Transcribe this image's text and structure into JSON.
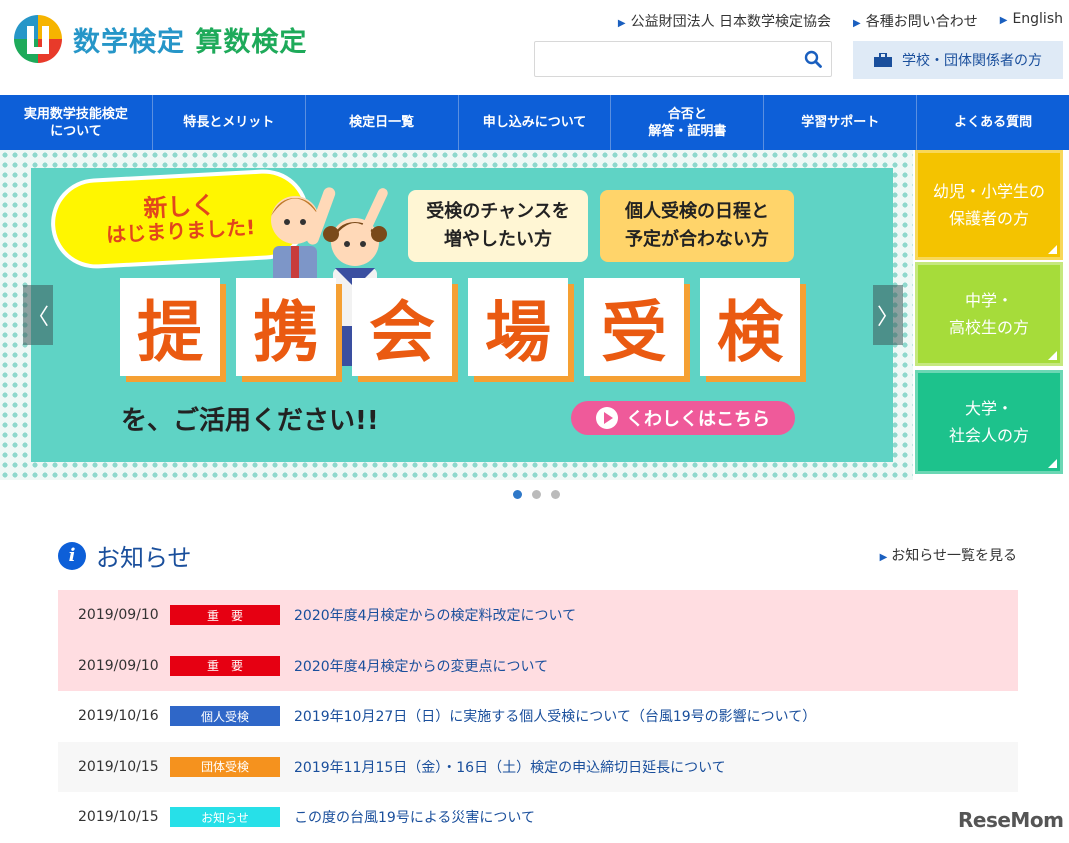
{
  "header": {
    "logo_text_a": "数学検定",
    "logo_text_b": "算数検定",
    "top_links": [
      "公益財団法人 日本数学検定協会",
      "各種お問い合わせ",
      "English"
    ],
    "search_placeholder": "",
    "school_button": "学校・団体関係者の方"
  },
  "nav": {
    "items": [
      "実用数学技能検定\nについて",
      "特長とメリット",
      "検定日一覧",
      "申し込みについて",
      "合否と\n解答・証明書",
      "学習サポート",
      "よくある質問"
    ]
  },
  "banner": {
    "bubble_line1": "新しく",
    "bubble_line2": "はじまりました!",
    "tag1": "受検のチャンスを\n増やしたい方",
    "tag2": "個人受検の日程と\n予定が合わない方",
    "big_chars": [
      "提",
      "携",
      "会",
      "場",
      "受",
      "検"
    ],
    "tagline": "を、ご活用ください!!",
    "more_button": "くわしくはこちら",
    "prev": "〈",
    "next": "〉"
  },
  "side_boxes": [
    "幼児・小学生の\n保護者の方",
    "中学・\n高校生の方",
    "大学・\n社会人の方"
  ],
  "slider_dots": {
    "count": 3,
    "active": 0
  },
  "news": {
    "title": "お知らせ",
    "more_link": "お知らせ一覧を見る",
    "items": [
      {
        "date": "2019/09/10",
        "badge": "重　要",
        "text": "2020年度4月検定からの検定料改定について"
      },
      {
        "date": "2019/09/10",
        "badge": "重　要",
        "text": "2020年度4月検定からの変更点について"
      },
      {
        "date": "2019/10/16",
        "badge": "個人受検",
        "text": "2019年10月27日（日）に実施する個人受検について（台風19号の影響について）"
      },
      {
        "date": "2019/10/15",
        "badge": "団体受検",
        "text": "2019年11月15日（金）・16日（土）検定の申込締切日延長について"
      },
      {
        "date": "2019/10/15",
        "badge": "お知らせ",
        "text": "この度の台風19号による災害について"
      }
    ]
  },
  "colors": {
    "nav_bg": "#0d5fd8",
    "important": "#e60012",
    "personal": "#2f67c8",
    "group": "#f5921e",
    "notice": "#27e0e8"
  },
  "watermark": "ReseMom"
}
